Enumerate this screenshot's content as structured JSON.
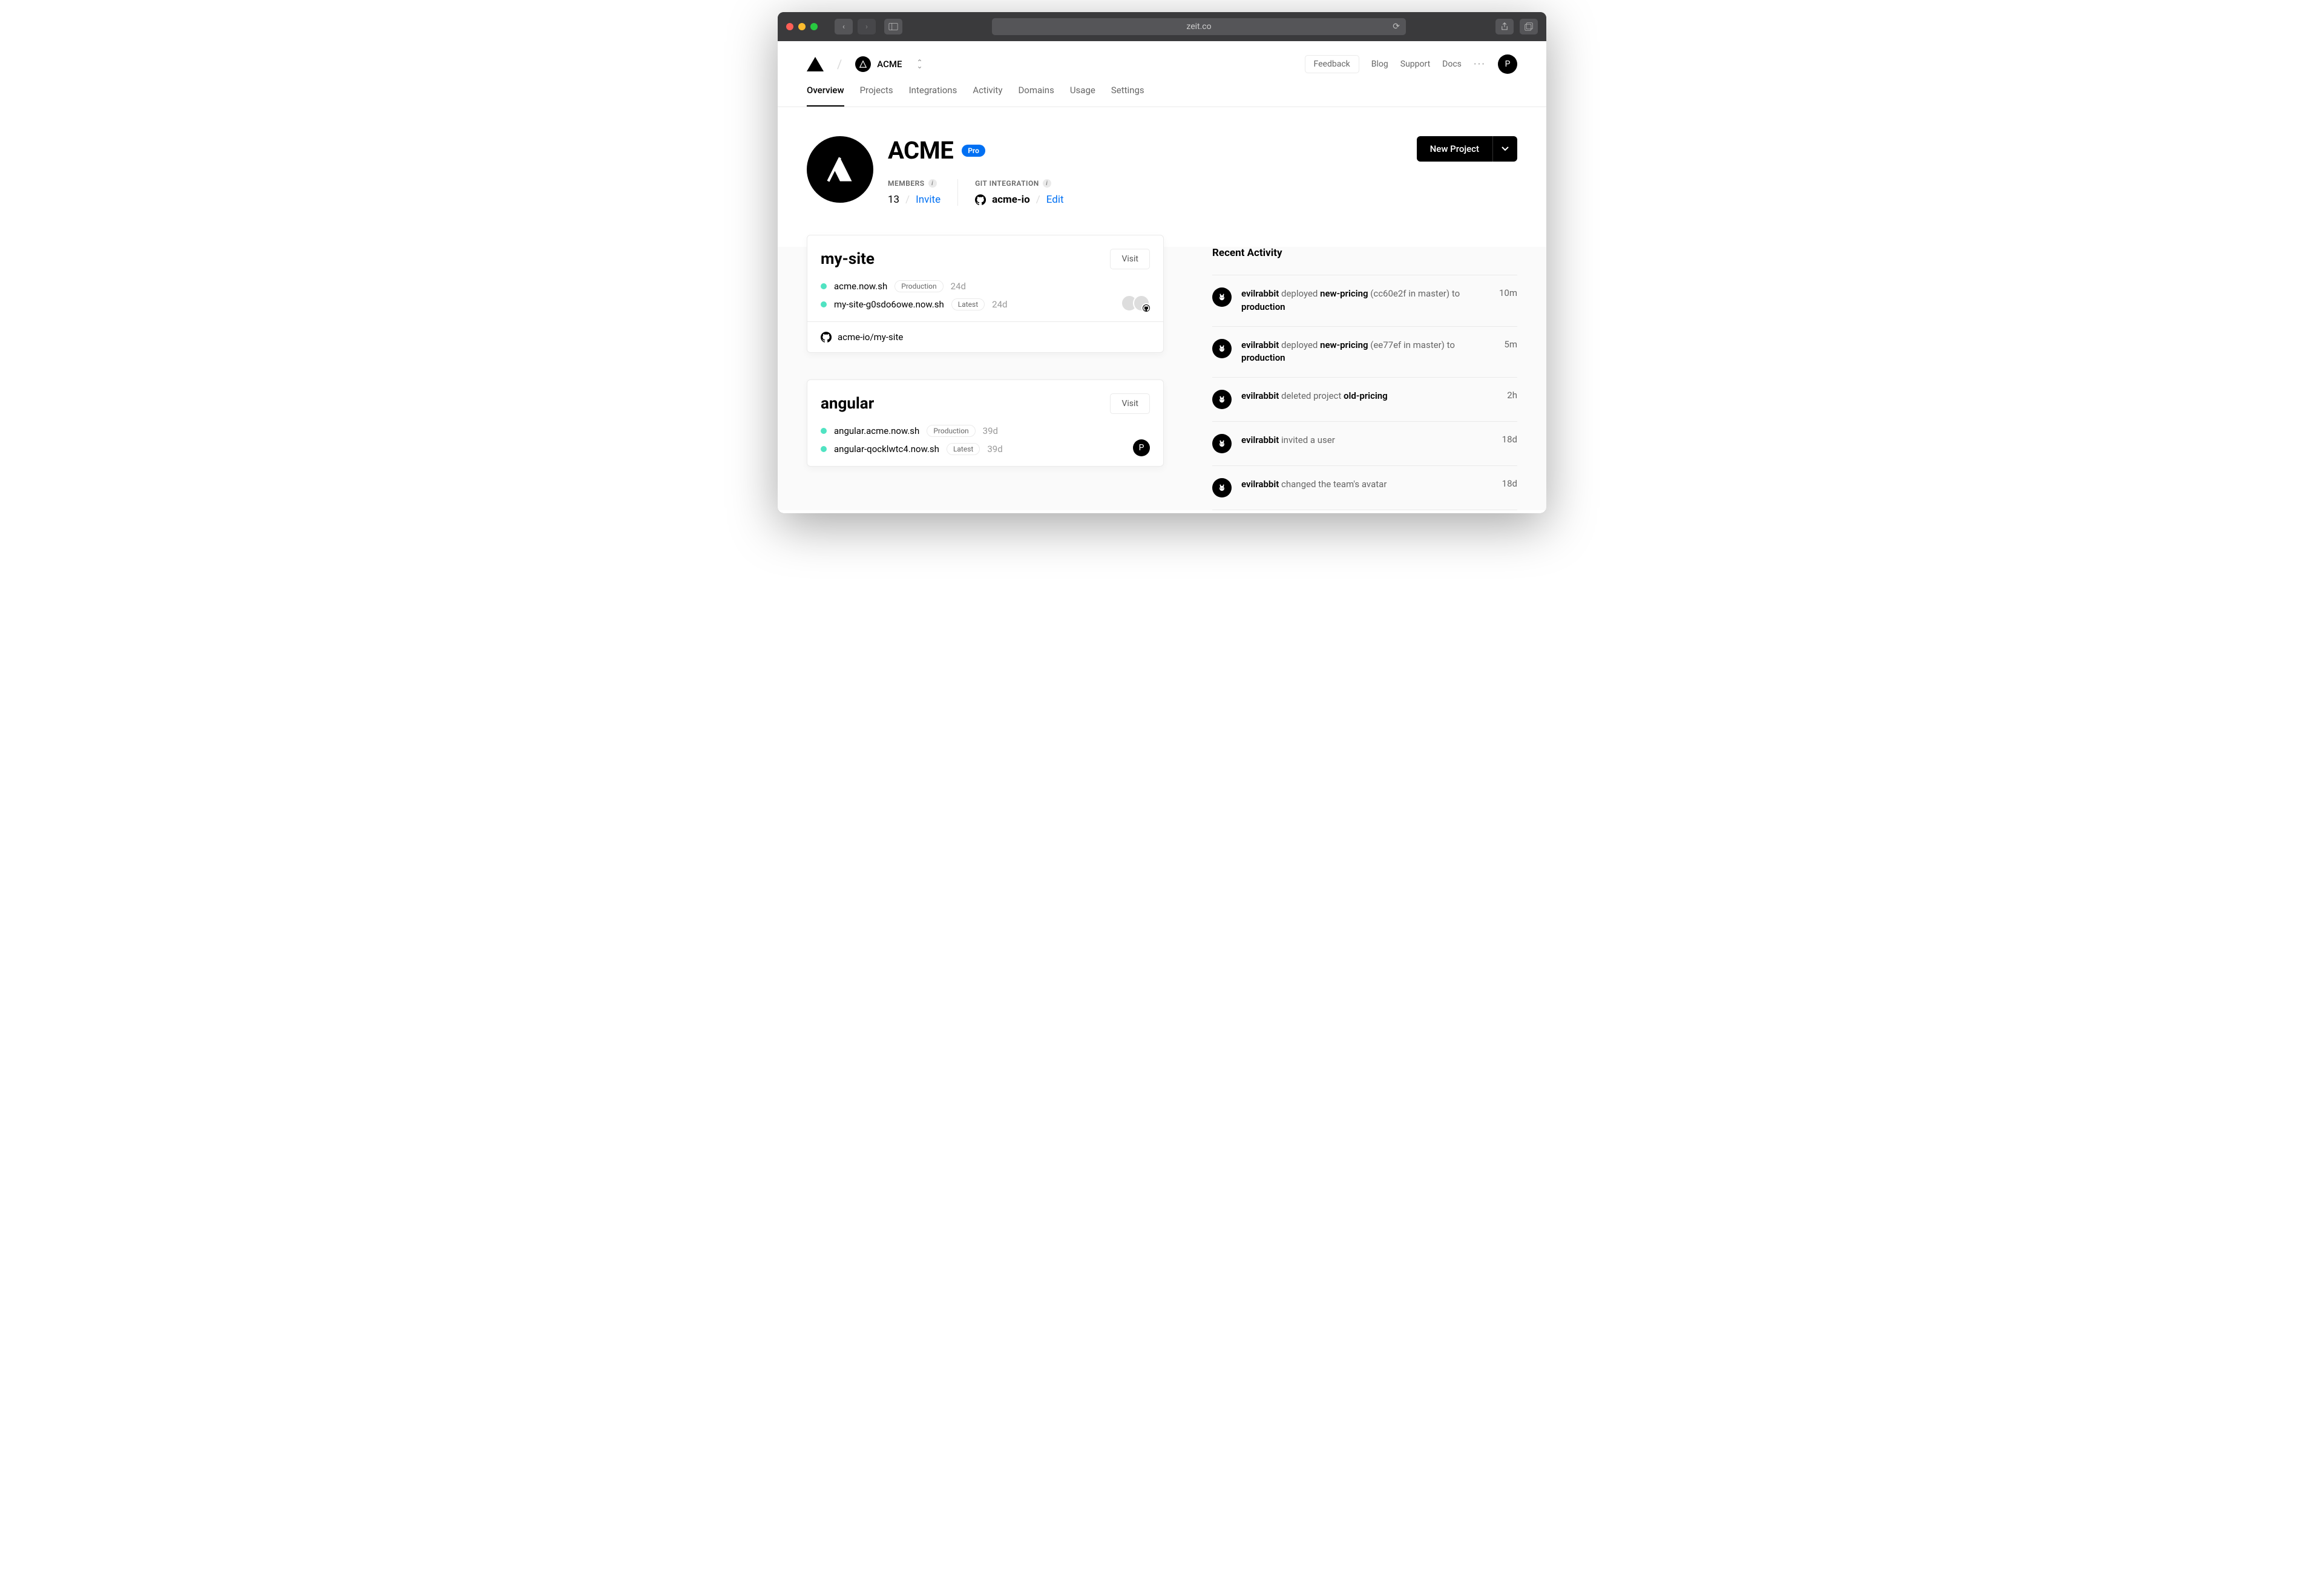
{
  "browser": {
    "url": "zeit.co"
  },
  "header": {
    "team_name": "ACME",
    "team_initial": "A",
    "feedback": "Feedback",
    "links": [
      "Blog",
      "Support",
      "Docs"
    ],
    "user_initial": "P"
  },
  "tabs": [
    {
      "label": "Overview",
      "active": true
    },
    {
      "label": "Projects",
      "active": false
    },
    {
      "label": "Integrations",
      "active": false
    },
    {
      "label": "Activity",
      "active": false
    },
    {
      "label": "Domains",
      "active": false
    },
    {
      "label": "Usage",
      "active": false
    },
    {
      "label": "Settings",
      "active": false
    }
  ],
  "team": {
    "name": "ACME",
    "plan_badge": "Pro",
    "members_label": "MEMBERS",
    "members_count": "13",
    "invite_label": "Invite",
    "git_label": "GIT INTEGRATION",
    "git_org": "acme-io",
    "git_edit": "Edit",
    "new_project": "New Project"
  },
  "projects": [
    {
      "name": "my-site",
      "visit": "Visit",
      "deploys": [
        {
          "url": "acme.now.sh",
          "env": "Production",
          "age": "24d"
        },
        {
          "url": "my-site-g0sdo6owe.now.sh",
          "env": "Latest",
          "age": "24d"
        }
      ],
      "repo": "acme-io/my-site",
      "has_repo_footer": true,
      "avatars": "stack"
    },
    {
      "name": "angular",
      "visit": "Visit",
      "deploys": [
        {
          "url": "angular.acme.now.sh",
          "env": "Production",
          "age": "39d"
        },
        {
          "url": "angular-qocklwtc4.now.sh",
          "env": "Latest",
          "age": "39d"
        }
      ],
      "has_repo_footer": false,
      "avatars": "solo"
    }
  ],
  "activity": {
    "title": "Recent Activity",
    "items": [
      {
        "html": "<b>evilrabbit</b> deployed <b>new-pricing</b> (cc60e2f in master) to <b>production</b>",
        "time": "10m"
      },
      {
        "html": "<b>evilrabbit</b> deployed <b>new-pricing</b> (ee77ef in master) to <b>production</b>",
        "time": "5m"
      },
      {
        "html": "<b>evilrabbit</b> deleted project <b>old-pricing</b>",
        "time": "2h"
      },
      {
        "html": "<b>evilrabbit</b> invited a user",
        "time": "18d"
      },
      {
        "html": "<b>evilrabbit</b> changed the team's avatar",
        "time": "18d"
      }
    ]
  }
}
